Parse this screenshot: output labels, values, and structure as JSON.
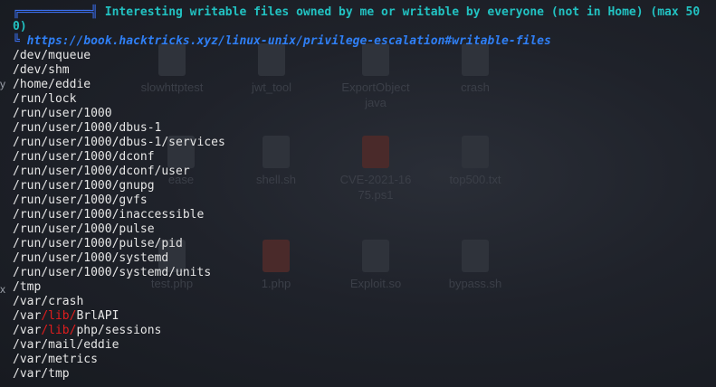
{
  "desktop": {
    "icons": [
      {
        "label": "slowhttptest"
      },
      {
        "label": "jwt_tool"
      },
      {
        "label": "ExportObject\njava"
      },
      {
        "label": "crash"
      },
      {
        "label": "ease"
      },
      {
        "label": "shell.sh"
      },
      {
        "label": "CVE-2021-16\n75.ps1"
      },
      {
        "label": "top500.txt"
      },
      {
        "label": "test.php"
      },
      {
        "label": "1.php"
      },
      {
        "label": "Exploit.so"
      },
      {
        "label": "bypass.sh"
      }
    ],
    "left_edge_chars": [
      "y",
      "x"
    ]
  },
  "terminal": {
    "header": {
      "box_art": "╔══════════╣",
      "text": " Interesting writable files owned by me or writable by everyone (not in Home) (max 50",
      "wrap": "0)"
    },
    "link": {
      "prefix": "╚ ",
      "url": "https://book.hacktricks.xyz/linux-unix/privilege-escalation#writable-files"
    },
    "paths": [
      "/dev/mqueue",
      "/dev/shm",
      "/home/eddie",
      "/run/lock",
      "/run/user/1000",
      "/run/user/1000/dbus-1",
      "/run/user/1000/dbus-1/services",
      "/run/user/1000/dconf",
      "/run/user/1000/dconf/user",
      "/run/user/1000/gnupg",
      "/run/user/1000/gvfs",
      "/run/user/1000/inaccessible",
      "/run/user/1000/pulse",
      "/run/user/1000/pulse/pid",
      "/run/user/1000/systemd",
      "/run/user/1000/systemd/units",
      "/tmp",
      "/var/crash"
    ],
    "highlighted_paths": [
      {
        "pre": "/var",
        "hl": "/lib/",
        "post": "BrlAPI"
      },
      {
        "pre": "/var",
        "hl": "/lib/",
        "post": "php/sessions"
      }
    ],
    "tail_paths": [
      "/var/mail/eddie",
      "/var/metrics",
      "/var/tmp"
    ]
  },
  "colors": {
    "header": "#22c2c2",
    "link": "#2f7ff5",
    "highlight": "#e11d1d",
    "text": "#e6e6e6",
    "background": "#1a1d24"
  }
}
